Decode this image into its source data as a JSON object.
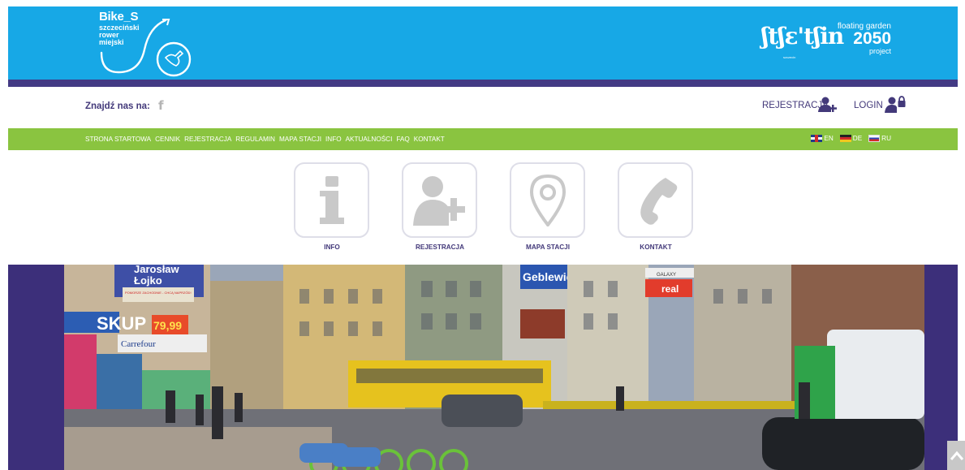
{
  "header": {
    "logo": {
      "brand": "Bike_S",
      "subtitle": [
        "szczeciński",
        "rower",
        "miejski"
      ]
    },
    "partner_logo": {
      "word": "ʃtʃɛ'tʃin",
      "tagline": "floating garden",
      "year": "2050",
      "project": "project",
      "small": "szczecin"
    }
  },
  "topbar": {
    "find_us": "Znajdź nas na:",
    "facebook_icon": "f",
    "register": "REJESTRACJA",
    "login": "LOGIN"
  },
  "nav": {
    "items": [
      "STRONA STARTOWA",
      "CENNIK",
      "REJESTRACJA",
      "REGULAMIN",
      "MAPA STACJI",
      "INFO",
      "AKTUALNOŚCI",
      "FAQ",
      "KONTAKT"
    ],
    "languages": [
      "EN",
      "DE",
      "RU"
    ]
  },
  "tiles": [
    {
      "label": "INFO",
      "icon": "info-icon"
    },
    {
      "label": "REJESTRACJA",
      "icon": "add-user-icon"
    },
    {
      "label": "MAPA STACJI",
      "icon": "map-pin-icon"
    },
    {
      "label": "KONTAKT",
      "icon": "phone-icon"
    }
  ],
  "banner": {
    "signs": {
      "jaroslaw_lojko": [
        "Jarosław",
        "Łojko"
      ],
      "pomorze": "POMORZE ZACHODNIE - CHCĄ NAPRZÓD!",
      "skup": "SKUP",
      "price": "79,99",
      "carrefour": "Carrefour",
      "geblewicz": "Geblewic",
      "galaxy": "GALAXY",
      "real": "real"
    }
  },
  "colors": {
    "header_blue": "#17a8e6",
    "purple": "#433a84",
    "nav_green": "#8ac440",
    "tile_border": "#dedee8",
    "icon_gray": "#c9c9c9"
  },
  "scroll_top_icon": "chevron-up-icon"
}
